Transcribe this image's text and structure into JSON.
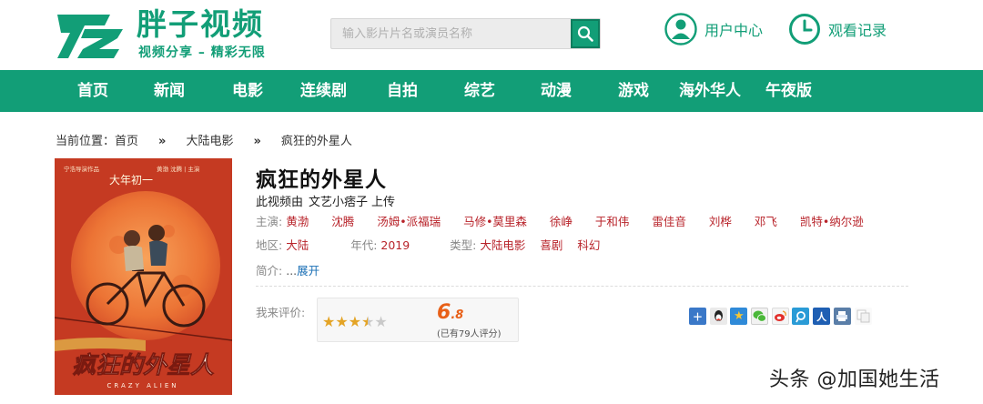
{
  "header": {
    "logo_text": "胖子视频",
    "logo_slogan": "视频分享 – 精彩无限",
    "search_placeholder": "输入影片片名或演员名称",
    "user_center": "用户中心",
    "history": "观看记录"
  },
  "nav": [
    "首页",
    "新闻",
    "电影",
    "连续剧",
    "自拍",
    "综艺",
    "动漫",
    "游戏",
    "海外华人",
    "午夜版"
  ],
  "breadcrumb": {
    "prefix": "当前位置：",
    "home": "首页",
    "sep": "»",
    "category": "大陆电影",
    "current": "疯狂的外星人"
  },
  "poster": {
    "top_tagline": "宁浩导演作品",
    "top_cast": "黄渤 沈腾 | 主演",
    "release": "大年初一",
    "title_cn": "疯狂的外星人",
    "title_en": "CRAZY ALIEN"
  },
  "movie": {
    "title": "疯狂的外星人",
    "uploader_prefix": "此视频由",
    "uploader": "文艺小痞子",
    "uploader_suffix": "上传",
    "cast_label": "主演:",
    "cast": [
      "黄渤",
      "沈腾",
      "汤姆•派福瑞",
      "马修•莫里森",
      "徐峥",
      "于和伟",
      "雷佳音",
      "刘桦",
      "邓飞",
      "凯特•纳尔逊"
    ],
    "region_label": "地区:",
    "region": "大陆",
    "year_label": "年代:",
    "year": "2019",
    "genre_label": "类型:",
    "genres": [
      "大陆电影",
      "喜剧",
      "科幻"
    ],
    "intro_label": "简介:",
    "intro_dots": "...",
    "intro_expand": "展开"
  },
  "rating": {
    "label": "我来评价:",
    "stars_filled": 3.5,
    "stars_total": 5,
    "score_int": "6",
    "score_dec": ".8",
    "votes": "(已有79人评分)"
  },
  "share_icons": [
    "more-share",
    "qq",
    "qzone",
    "wechat",
    "weibo",
    "tencent-weibo",
    "renren",
    "print",
    "copy"
  ],
  "watermark": "头条 @加国她生活",
  "colors": {
    "brand": "#129e77",
    "link_red": "#b8232a",
    "score": "#e86018"
  }
}
